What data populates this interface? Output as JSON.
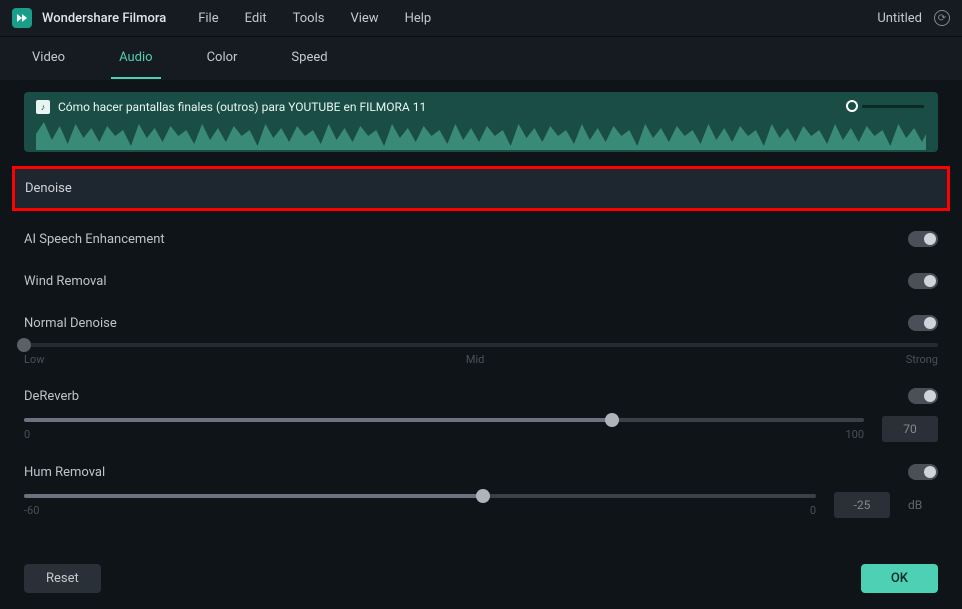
{
  "titlebar": {
    "app_name": "Wondershare Filmora",
    "menu": [
      "File",
      "Edit",
      "Tools",
      "View",
      "Help"
    ],
    "project": "Untitled"
  },
  "tabs": [
    "Video",
    "Audio",
    "Color",
    "Speed"
  ],
  "active_tab": "Audio",
  "clip": {
    "title": "Cómo hacer pantallas finales (outros) para YOUTUBE en FILMORA 11"
  },
  "section": {
    "denoise": "Denoise"
  },
  "controls": {
    "ai_speech": {
      "label": "AI Speech Enhancement"
    },
    "wind_removal": {
      "label": "Wind Removal"
    },
    "normal_denoise": {
      "label": "Normal Denoise",
      "ticks": {
        "low": "Low",
        "mid": "Mid",
        "strong": "Strong"
      }
    },
    "dereverb": {
      "label": "DeReverb",
      "min": "0",
      "max": "100",
      "value": "70"
    },
    "hum_removal": {
      "label": "Hum Removal",
      "min": "-60",
      "max": "0",
      "value": "-25",
      "unit": "dB"
    }
  },
  "footer": {
    "reset": "Reset",
    "ok": "OK"
  }
}
